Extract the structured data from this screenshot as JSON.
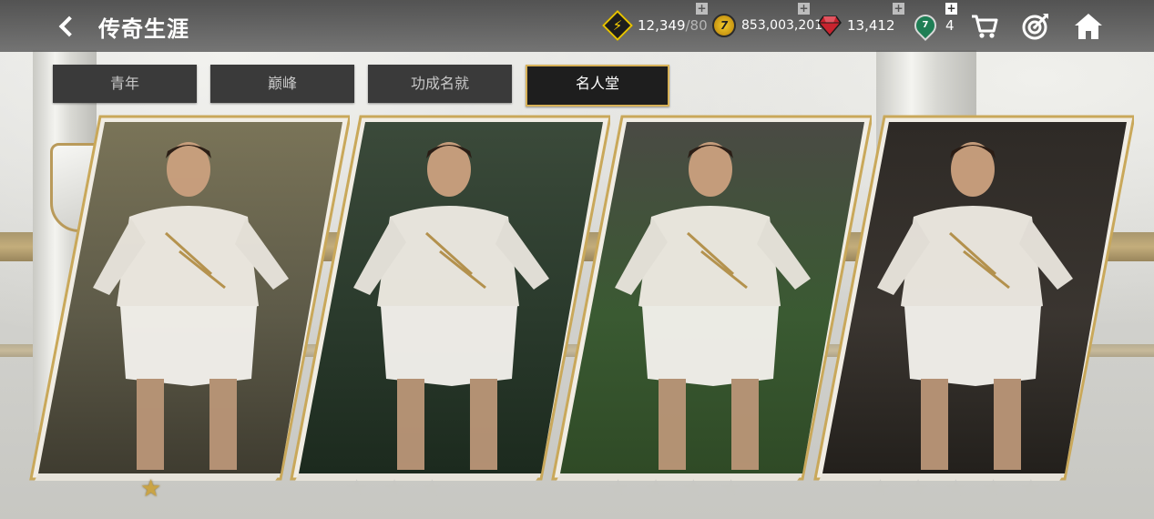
{
  "header": {
    "title": "传奇生涯"
  },
  "currencies": [
    {
      "name": "energy",
      "value": "12,349",
      "suffix": "/80",
      "icon": "bolt-icon",
      "color": "#ffd400"
    },
    {
      "name": "coins",
      "value": "853,003,201",
      "icon": "coin-icon",
      "color": "#e8b81c"
    },
    {
      "name": "gems",
      "value": "13,412",
      "icon": "gem-icon",
      "color": "#c8232e"
    },
    {
      "name": "points",
      "value": "4",
      "icon": "points-icon",
      "color": "#1f7e55"
    }
  ],
  "nav": {
    "icons": [
      "cart-icon",
      "target-icon",
      "home-icon"
    ]
  },
  "tabs": [
    {
      "label": "青年"
    },
    {
      "label": "巅峰"
    },
    {
      "label": "功成名就"
    },
    {
      "label": "名人堂",
      "active": true
    }
  ],
  "cards": [
    {
      "stars_total": 1,
      "stars_filled": 1,
      "image": "player-portrait-youth"
    },
    {
      "stars_total": 3,
      "stars_filled": 0,
      "image": "player-portrait-peak"
    },
    {
      "stars_total": 4,
      "stars_filled": 0,
      "image": "player-portrait-success"
    },
    {
      "stars_total": 5,
      "stars_filled": 0,
      "image": "player-portrait-hall-of-fame"
    }
  ],
  "colors": {
    "accent_gold": "#d8b258",
    "topbar": "#4a4a4a",
    "tab_bg": "#3a3a3a"
  }
}
